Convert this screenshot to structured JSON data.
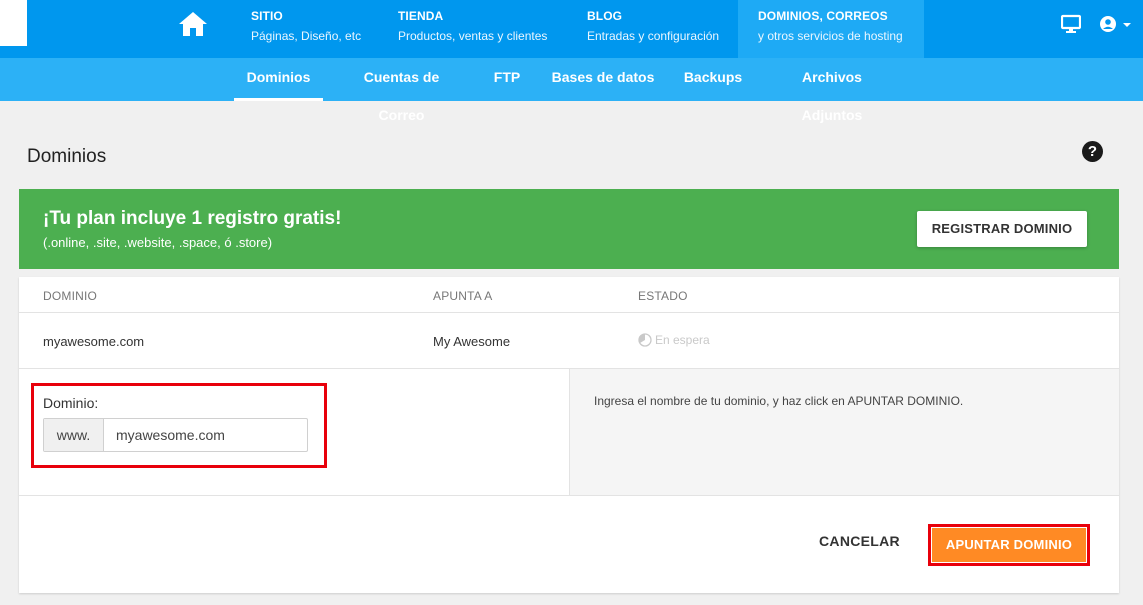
{
  "nav": {
    "items": [
      {
        "title": "SITIO",
        "subtitle": "Páginas, Diseño, etc"
      },
      {
        "title": "TIENDA",
        "subtitle": "Productos, ventas y clientes"
      },
      {
        "title": "BLOG",
        "subtitle": "Entradas y configuración"
      },
      {
        "title": "DOMINIOS, CORREOS",
        "subtitle": "y otros servicios de hosting"
      }
    ],
    "icons": {
      "home": "home-icon",
      "monitor": "monitor-icon",
      "account": "account-circle-icon"
    }
  },
  "subnav": {
    "tabs": [
      {
        "label": "Dominios"
      },
      {
        "label": "Cuentas de Correo"
      },
      {
        "label": "FTP"
      },
      {
        "label": "Bases de datos"
      },
      {
        "label": "Backups"
      },
      {
        "label": "Archivos Adjuntos"
      }
    ]
  },
  "page": {
    "title": "Dominios",
    "help": "?"
  },
  "banner": {
    "title": "¡Tu plan incluye 1 registro gratis!",
    "subtitle": "(.online, .site, .website, .space, ó .store)",
    "button": "REGISTRAR DOMINIO"
  },
  "table": {
    "headers": [
      "DOMINIO",
      "APUNTA A",
      "ESTADO"
    ],
    "rows": [
      {
        "domain": "myawesome.com",
        "points_to": "My Awesome",
        "status": "En espera"
      }
    ]
  },
  "form": {
    "label": "Dominio:",
    "prefix": "www.",
    "value": "myawesome.com",
    "hint": "Ingresa el nombre de tu dominio, y haz click en APUNTAR DOMINIO.",
    "cancel": "CANCELAR",
    "submit": "APUNTAR DOMINIO"
  },
  "colors": {
    "topbar": "#0097ee",
    "subbar": "#2cb1f6",
    "banner": "#4caf50",
    "submit": "#ff8a24",
    "highlight": "#e8000b"
  }
}
